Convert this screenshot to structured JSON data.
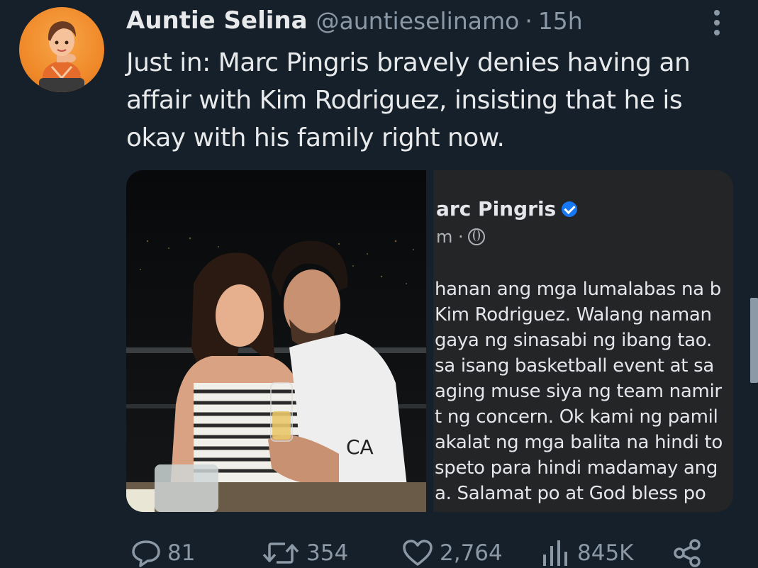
{
  "author": {
    "display_name": "Auntie Selina",
    "handle": "@auntieselinamo",
    "separator": "·",
    "time": "15h"
  },
  "tweet": {
    "text": "Just in: Marc Pingris bravely denies having an affair with Kim Rodriguez, insisting that he is okay with his family right now."
  },
  "fb_post": {
    "name": "arc Pingris",
    "meta": "m ·",
    "lines": [
      "hanan ang mga lumalabas na b",
      " Kim Rodriguez. Walang naman",
      "gaya ng sinasabi ng ibang tao.",
      "sa isang basketball event at sa",
      "aging muse siya ng team namir",
      "t ng concern. Ok kami ng pamil",
      "akalat ng mga balita na hindi to",
      "speto  para hindi madamay ang",
      "a. Salamat po at God bless po"
    ]
  },
  "photo": {
    "shirt_text": "CA"
  },
  "actions": {
    "replies": "81",
    "retweets": "354",
    "likes": "2,764",
    "views": "845K"
  },
  "icons": {
    "reply": "reply-icon",
    "retweet": "retweet-icon",
    "like": "heart-icon",
    "views": "views-icon",
    "share": "share-icon",
    "more": "more-vertical-icon",
    "verified": "verified-badge-icon",
    "globe": "globe-icon"
  },
  "colors": {
    "background": "#15202b",
    "secondary_text": "#8b98a5",
    "verified_blue": "#1877f2"
  }
}
